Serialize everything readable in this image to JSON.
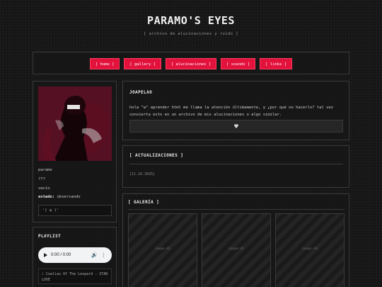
{
  "site": {
    "title": "PARAMO'S EYES",
    "subtitle": "[ archivo de alucinaciones y ruido ]"
  },
  "nav": {
    "items": [
      {
        "label": "[ home ]"
      },
      {
        "label": "[ gallery ]"
      },
      {
        "label": "[ alucinaciones ]"
      },
      {
        "label": "[ sounds ]"
      },
      {
        "label": "[ links ]"
      }
    ],
    "accent_color": "#e3123c"
  },
  "profile": {
    "name": "paramo",
    "line2": "???",
    "line3": "vacío",
    "status_label": "estado:",
    "status_value": "observando",
    "status_box": "'( ◎ )'"
  },
  "playlist": {
    "title": "PLAYLIST",
    "time": "0:00 / 0:00",
    "track": "♪ Coalias Of The Leopard - STAR LOVE"
  },
  "intro": {
    "title": "JOAPELAO",
    "text": "hola ^w^ aprender html me llama la atención últimamente, y ¿por qué no hacerlo? tal vez convierta esto en un archivo de mis alucinaciones o algo similar.",
    "icon": "heart-icon"
  },
  "updates": {
    "title": "[ ACTUALIZACIONES ]",
    "date": "[11.10.2025]"
  },
  "gallery": {
    "title": "[ GALERÍA ]",
    "tiles": [
      {
        "label": "imagen 01"
      },
      {
        "label": "imagen 02"
      },
      {
        "label": "imagen 03"
      }
    ]
  }
}
